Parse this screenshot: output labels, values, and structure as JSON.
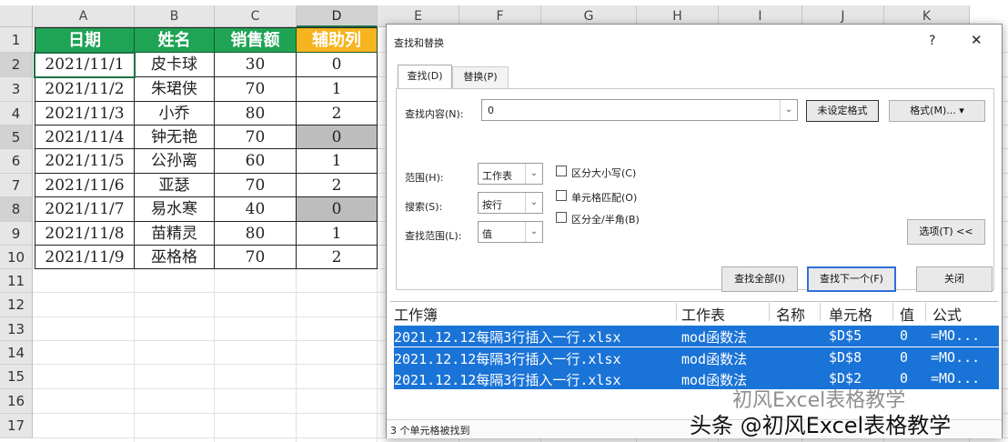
{
  "columns": [
    "A",
    "B",
    "C",
    "D",
    "E",
    "F",
    "G",
    "H",
    "I",
    "J",
    "K"
  ],
  "rows": [
    "1",
    "2",
    "3",
    "4",
    "5",
    "6",
    "7",
    "8",
    "9",
    "10",
    "11",
    "12",
    "13",
    "14",
    "15",
    "16",
    "17"
  ],
  "headers": [
    "日期",
    "姓名",
    "销售额",
    "辅助列"
  ],
  "table": [
    [
      "2021/11/1",
      "皮卡球",
      "30",
      "0"
    ],
    [
      "2021/11/2",
      "朱珺侠",
      "70",
      "1"
    ],
    [
      "2021/11/3",
      "小乔",
      "80",
      "2"
    ],
    [
      "2021/11/4",
      "钟无艳",
      "70",
      "0"
    ],
    [
      "2021/11/5",
      "公孙离",
      "60",
      "1"
    ],
    [
      "2021/11/6",
      "亚瑟",
      "70",
      "2"
    ],
    [
      "2021/11/7",
      "易水寒",
      "40",
      "0"
    ],
    [
      "2021/11/8",
      "苗精灵",
      "80",
      "1"
    ],
    [
      "2021/11/9",
      "巫格格",
      "70",
      "2"
    ]
  ],
  "colors": {
    "header_green": "#1fa355",
    "header_orange": "#f6b41f",
    "selection_blue": "#1a73d6"
  },
  "dialog": {
    "title": "查找和替换",
    "help": "?",
    "close": "✕",
    "tabs": [
      "查找(D)",
      "替换(P)"
    ],
    "find_label": "查找内容(N):",
    "find_value": "0",
    "no_format": "未设定格式",
    "format": "格式(M)...",
    "within_label": "范围(H):",
    "within_value": "工作表",
    "search_label": "搜索(S):",
    "search_value": "按行",
    "lookin_label": "查找范围(L):",
    "lookin_value": "值",
    "opt_case": "区分大小写(C)",
    "opt_cell": "单元格匹配(O)",
    "opt_width": "区分全/半角(B)",
    "options_btn": "选项(T) <<",
    "find_all": "查找全部(I)",
    "find_next": "查找下一个(F)",
    "close_btn": "关闭",
    "result_headers": [
      "工作簿",
      "工作表",
      "名称",
      "单元格",
      "值",
      "公式"
    ],
    "results": [
      [
        "2021.12.12每隔3行插入一行.xlsx",
        "mod函数法",
        "",
        "$D$5",
        "0",
        "=MO..."
      ],
      [
        "2021.12.12每隔3行插入一行.xlsx",
        "mod函数法",
        "",
        "$D$8",
        "0",
        "=MO..."
      ],
      [
        "2021.12.12每隔3行插入一行.xlsx",
        "mod函数法",
        "",
        "$D$2",
        "0",
        "=MO..."
      ]
    ],
    "status": "3 个单元格被找到"
  },
  "watermark": "头条 @初风Excel表格教学",
  "watermark_bg": "初风Excel表格教学"
}
